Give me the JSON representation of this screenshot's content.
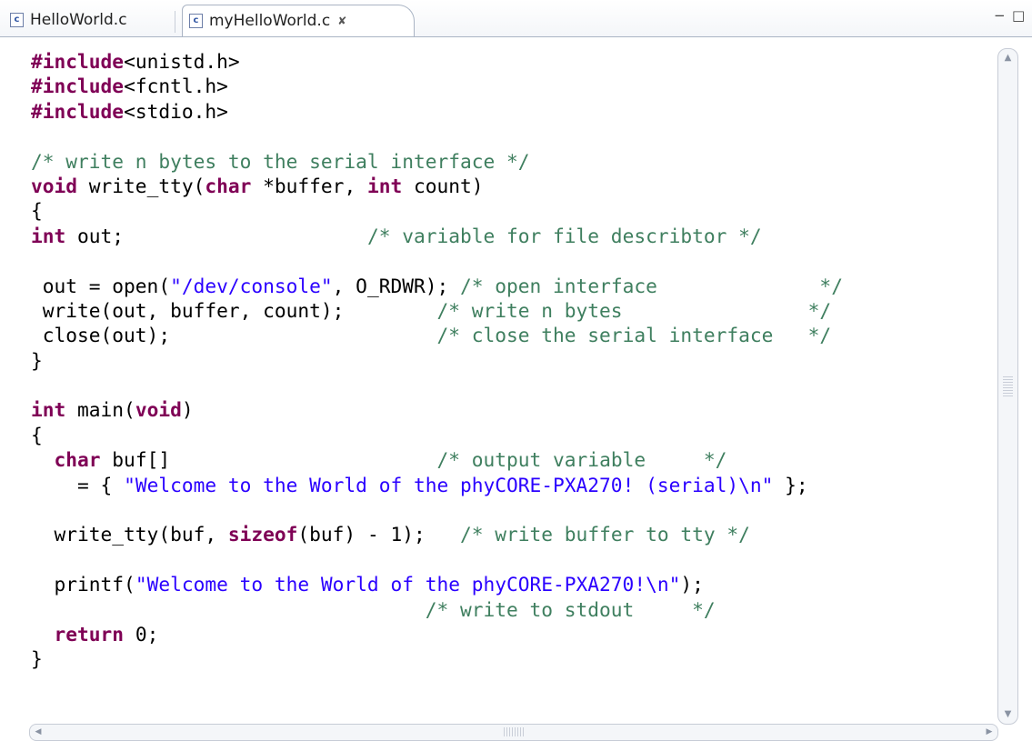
{
  "tabs": [
    {
      "label": "HelloWorld.c",
      "icon": "c-source-file-icon",
      "active": false
    },
    {
      "label": "myHelloWorld.c",
      "icon": "c-source-file-icon",
      "active": true,
      "close_glyph": "✘"
    }
  ],
  "window_controls": {
    "minimize": "−",
    "maximize": "□"
  },
  "colors": {
    "keyword": "#7f0055",
    "comment": "#3f7f5f",
    "string": "#2a00ff",
    "current_line": "#e8f2fe"
  },
  "code_lines": [
    [
      [
        "kw",
        "#include"
      ],
      [
        "",
        "<unistd.h>"
      ]
    ],
    [
      [
        "kw",
        "#include"
      ],
      [
        "",
        "<fcntl.h>"
      ]
    ],
    [
      [
        "kw",
        "#include"
      ],
      [
        "",
        "<stdio.h>"
      ]
    ],
    [],
    [
      [
        "cm",
        "/* write n bytes to the serial interface */"
      ]
    ],
    [
      [
        "kw",
        "void"
      ],
      [
        "",
        " write_tty("
      ],
      [
        "kw",
        "char"
      ],
      [
        "",
        " *buffer, "
      ],
      [
        "kw",
        "int"
      ],
      [
        "",
        " count)"
      ]
    ],
    [
      [
        "",
        "{"
      ]
    ],
    [
      [
        "",
        ""
      ],
      [
        "kw",
        "int"
      ],
      [
        "",
        " out;                     "
      ],
      [
        "cm",
        "/* variable for file describtor */"
      ]
    ],
    [],
    [
      [
        "",
        " out = open("
      ],
      [
        "st",
        "\"/dev/console\""
      ],
      [
        "",
        ", O_RDWR); "
      ],
      [
        "cm",
        "/* open interface              */"
      ]
    ],
    [
      [
        "",
        " write(out, buffer, count);        "
      ],
      [
        "cm",
        "/* write n bytes                */"
      ]
    ],
    [
      [
        "",
        " close(out);                       "
      ],
      [
        "cm",
        "/* close the serial interface   */"
      ]
    ],
    [
      [
        "",
        "}"
      ]
    ],
    [],
    [
      [
        "kw",
        "int"
      ],
      [
        "",
        " main("
      ],
      [
        "kw",
        "void"
      ],
      [
        "",
        ")"
      ]
    ],
    [
      [
        "",
        "{"
      ]
    ],
    [
      [
        "",
        "  "
      ],
      [
        "kw",
        "char"
      ],
      [
        "",
        " buf[]                       "
      ],
      [
        "cm",
        "/* output variable     */"
      ]
    ],
    [
      [
        "",
        "    = { "
      ],
      [
        "st",
        "\"Welcome to the World of the phyCORE-PXA270! (serial)\\n\""
      ],
      [
        "",
        " };"
      ]
    ],
    [],
    [
      [
        "",
        "  write_tty(buf, "
      ],
      [
        "kw",
        "sizeof"
      ],
      [
        "",
        "(buf) - 1);   "
      ],
      [
        "cm",
        "/* write buffer to tty */"
      ]
    ],
    [],
    [
      [
        "",
        "  printf("
      ],
      [
        "st",
        "\"Welcome to the World of the phyCORE-PXA270!\\n\""
      ],
      [
        "",
        ");"
      ]
    ],
    [
      [
        "",
        "                                  "
      ],
      [
        "cm",
        "/* write to stdout     */"
      ]
    ],
    [
      [
        "",
        "  "
      ],
      [
        "kw",
        "return"
      ],
      [
        "",
        " 0;"
      ]
    ],
    [
      [
        "",
        "}"
      ]
    ]
  ],
  "current_line_index": 7
}
